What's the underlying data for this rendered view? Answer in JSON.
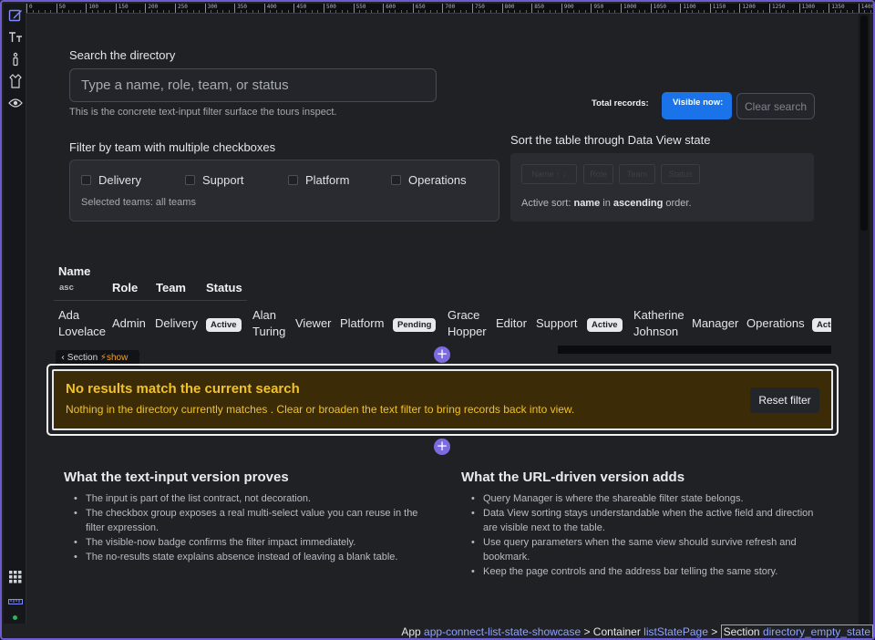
{
  "ruler": {
    "labels": [
      "0",
      "50",
      "100",
      "150",
      "200",
      "250",
      "300",
      "350",
      "400",
      "450",
      "500",
      "550",
      "600",
      "650",
      "700",
      "750",
      "800",
      "850",
      "900",
      "950",
      "1000",
      "1050",
      "1100",
      "1150",
      "1200",
      "1250",
      "1300",
      "1350",
      "1400"
    ]
  },
  "rail": {
    "icons": [
      "edit-icon",
      "text-style-icon",
      "info-icon",
      "shirt-icon",
      "eye-icon",
      "grid-apps-icon",
      "ruler-icon"
    ]
  },
  "search": {
    "label": "Search the directory",
    "placeholder": "Type a name, role, team, or status",
    "value": "",
    "hint": "This is the concrete text-input filter surface the tours inspect."
  },
  "stats": {
    "total_records": "Total records:",
    "visible_now": "Visible now:",
    "clear_search": "Clear search"
  },
  "filter": {
    "label": "Filter by team with multiple checkboxes",
    "teams": [
      "Delivery",
      "Support",
      "Platform",
      "Operations"
    ],
    "selected": "Selected teams: all teams"
  },
  "sort": {
    "label": "Sort the table through Data View state",
    "buttons": [
      "Name ↑ ↓",
      "Role",
      "Team",
      "Status"
    ],
    "active_prefix": "Active sort: ",
    "active_field": "name",
    "active_middle": " in ",
    "active_direction": "ascending",
    "active_suffix": " order."
  },
  "table": {
    "headers": [
      "Name",
      "Role",
      "Team",
      "Status"
    ],
    "name_sub": "asc",
    "rows": [
      {
        "name_1": "Ada",
        "name_2": "Lovelace",
        "role": "Admin",
        "team": "Delivery",
        "status": "Active"
      },
      {
        "name_1": "Alan",
        "name_2": "Turing",
        "role": "Viewer",
        "team": "Platform",
        "status": "Pending"
      },
      {
        "name_1": "Grace",
        "name_2": "Hopper",
        "role": "Editor",
        "team": "Support",
        "status": "Active"
      },
      {
        "name_1": "Katherine",
        "name_2": "Johnson",
        "role": "Manager",
        "team": "Operations",
        "status": "Active"
      }
    ]
  },
  "section_tag": {
    "label": "Section",
    "action": "show"
  },
  "empty_state": {
    "title": "No results match the current search",
    "text": "Nothing in the directory currently matches . Clear or broaden the text filter to bring records back into view.",
    "reset": "Reset filter"
  },
  "explain_left": {
    "title": "What the text-input version proves",
    "items": [
      "The input is part of the list contract, not decoration.",
      "The checkbox group exposes a real multi-select value you can reuse in the",
      "filter expression.",
      "The visible-now badge confirms the filter impact immediately.",
      "The no-results state explains absence instead of leaving a blank table."
    ]
  },
  "explain_right": {
    "title": "What the URL-driven version adds",
    "items": [
      "Query Manager is where the shareable filter state belongs.",
      "Data View sorting stays understandable when the active field and direction",
      "are visible next to the table.",
      "Use query parameters when the same view should survive refresh and",
      "bookmark.",
      "Keep the page controls and the address bar telling the same story."
    ]
  },
  "breadcrumb": {
    "app_label": "App ",
    "app_name": "app-connect-list-state-showcase",
    "container_label": " > Container ",
    "container_name": "listStatePage",
    "section_sep": " > ",
    "section_label": "Section ",
    "section_name": "directory_empty_state"
  },
  "colors": {
    "accent": "#1a73e8",
    "frame": "#6d5bd0",
    "warning_bg": "#3b2b07",
    "warning_text": "#f0c22a",
    "link": "#8fa2ff"
  }
}
